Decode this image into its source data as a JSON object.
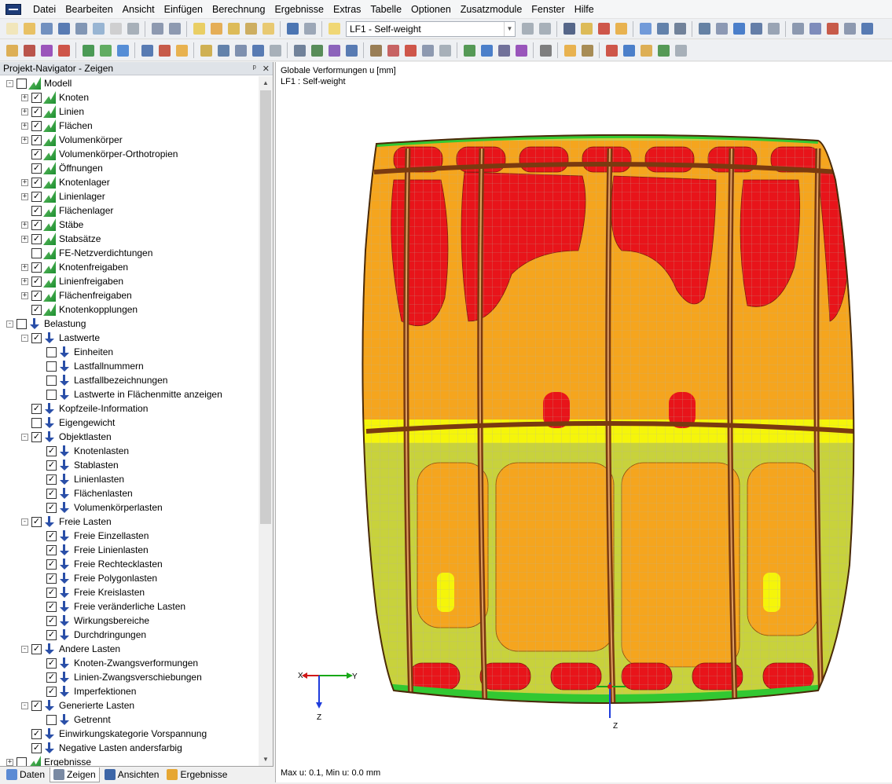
{
  "menu": [
    "Datei",
    "Bearbeiten",
    "Ansicht",
    "Einfügen",
    "Berechnung",
    "Ergebnisse",
    "Extras",
    "Tabelle",
    "Optionen",
    "Zusatzmodule",
    "Fenster",
    "Hilfe"
  ],
  "toolbar": {
    "loadcase": "LF1 - Self-weight"
  },
  "navigator": {
    "title": "Projekt-Navigator - Zeigen",
    "pin": "ᵖ",
    "close": "✕",
    "tree": [
      {
        "label": "Modell",
        "level": 0,
        "exp": "-",
        "checked": false,
        "icon": "model"
      },
      {
        "label": "Knoten",
        "level": 1,
        "exp": "+",
        "checked": true,
        "icon": "model"
      },
      {
        "label": "Linien",
        "level": 1,
        "exp": "+",
        "checked": true,
        "icon": "model"
      },
      {
        "label": "Flächen",
        "level": 1,
        "exp": "+",
        "checked": true,
        "icon": "model"
      },
      {
        "label": "Volumenkörper",
        "level": 1,
        "exp": "+",
        "checked": true,
        "icon": "model"
      },
      {
        "label": "Volumenkörper-Orthotropien",
        "level": 1,
        "exp": "",
        "checked": true,
        "icon": "model"
      },
      {
        "label": "Öffnungen",
        "level": 1,
        "exp": "",
        "checked": true,
        "icon": "model"
      },
      {
        "label": "Knotenlager",
        "level": 1,
        "exp": "+",
        "checked": true,
        "icon": "model"
      },
      {
        "label": "Linienlager",
        "level": 1,
        "exp": "+",
        "checked": true,
        "icon": "model"
      },
      {
        "label": "Flächenlager",
        "level": 1,
        "exp": "",
        "checked": true,
        "icon": "model"
      },
      {
        "label": "Stäbe",
        "level": 1,
        "exp": "+",
        "checked": true,
        "icon": "model"
      },
      {
        "label": "Stabsätze",
        "level": 1,
        "exp": "+",
        "checked": true,
        "icon": "model"
      },
      {
        "label": "FE-Netzverdichtungen",
        "level": 1,
        "exp": "",
        "checked": false,
        "icon": "model"
      },
      {
        "label": "Knotenfreigaben",
        "level": 1,
        "exp": "+",
        "checked": true,
        "icon": "model"
      },
      {
        "label": "Linienfreigaben",
        "level": 1,
        "exp": "+",
        "checked": true,
        "icon": "model"
      },
      {
        "label": "Flächenfreigaben",
        "level": 1,
        "exp": "+",
        "checked": true,
        "icon": "model"
      },
      {
        "label": "Knotenkopplungen",
        "level": 1,
        "exp": "",
        "checked": true,
        "icon": "model"
      },
      {
        "label": "Belastung",
        "level": 0,
        "exp": "-",
        "checked": false,
        "icon": "load"
      },
      {
        "label": "Lastwerte",
        "level": 1,
        "exp": "-",
        "checked": true,
        "icon": "load"
      },
      {
        "label": "Einheiten",
        "level": 2,
        "exp": "",
        "checked": false,
        "icon": "load"
      },
      {
        "label": "Lastfallnummern",
        "level": 2,
        "exp": "",
        "checked": false,
        "icon": "load"
      },
      {
        "label": "Lastfallbezeichnungen",
        "level": 2,
        "exp": "",
        "checked": false,
        "icon": "load"
      },
      {
        "label": "Lastwerte in Flächenmitte anzeigen",
        "level": 2,
        "exp": "",
        "checked": false,
        "icon": "load"
      },
      {
        "label": "Kopfzeile-Information",
        "level": 1,
        "exp": "",
        "checked": true,
        "icon": "load"
      },
      {
        "label": "Eigengewicht",
        "level": 1,
        "exp": "",
        "checked": false,
        "icon": "load"
      },
      {
        "label": "Objektlasten",
        "level": 1,
        "exp": "-",
        "checked": true,
        "icon": "load"
      },
      {
        "label": "Knotenlasten",
        "level": 2,
        "exp": "",
        "checked": true,
        "icon": "load"
      },
      {
        "label": "Stablasten",
        "level": 2,
        "exp": "",
        "checked": true,
        "icon": "load"
      },
      {
        "label": "Linienlasten",
        "level": 2,
        "exp": "",
        "checked": true,
        "icon": "load"
      },
      {
        "label": "Flächenlasten",
        "level": 2,
        "exp": "",
        "checked": true,
        "icon": "load"
      },
      {
        "label": "Volumenkörperlasten",
        "level": 2,
        "exp": "",
        "checked": true,
        "icon": "load"
      },
      {
        "label": "Freie Lasten",
        "level": 1,
        "exp": "-",
        "checked": true,
        "icon": "load"
      },
      {
        "label": "Freie Einzellasten",
        "level": 2,
        "exp": "",
        "checked": true,
        "icon": "load"
      },
      {
        "label": "Freie Linienlasten",
        "level": 2,
        "exp": "",
        "checked": true,
        "icon": "load"
      },
      {
        "label": "Freie Rechtecklasten",
        "level": 2,
        "exp": "",
        "checked": true,
        "icon": "load"
      },
      {
        "label": "Freie Polygonlasten",
        "level": 2,
        "exp": "",
        "checked": true,
        "icon": "load"
      },
      {
        "label": "Freie Kreislasten",
        "level": 2,
        "exp": "",
        "checked": true,
        "icon": "load"
      },
      {
        "label": "Freie veränderliche Lasten",
        "level": 2,
        "exp": "",
        "checked": true,
        "icon": "load"
      },
      {
        "label": "Wirkungsbereiche",
        "level": 2,
        "exp": "",
        "checked": true,
        "icon": "load"
      },
      {
        "label": "Durchdringungen",
        "level": 2,
        "exp": "",
        "checked": true,
        "icon": "load"
      },
      {
        "label": "Andere Lasten",
        "level": 1,
        "exp": "-",
        "checked": true,
        "icon": "load"
      },
      {
        "label": "Knoten-Zwangsverformungen",
        "level": 2,
        "exp": "",
        "checked": true,
        "icon": "load"
      },
      {
        "label": "Linien-Zwangsverschiebungen",
        "level": 2,
        "exp": "",
        "checked": true,
        "icon": "load"
      },
      {
        "label": "Imperfektionen",
        "level": 2,
        "exp": "",
        "checked": true,
        "icon": "load"
      },
      {
        "label": "Generierte Lasten",
        "level": 1,
        "exp": "-",
        "checked": true,
        "icon": "load"
      },
      {
        "label": "Getrennt",
        "level": 2,
        "exp": "",
        "checked": false,
        "icon": "load"
      },
      {
        "label": "Einwirkungskategorie Vorspannung",
        "level": 1,
        "exp": "",
        "checked": true,
        "icon": "load"
      },
      {
        "label": "Negative Lasten andersfarbig",
        "level": 1,
        "exp": "",
        "checked": true,
        "icon": "load"
      },
      {
        "label": "Ergebnisse",
        "level": 0,
        "exp": "+",
        "checked": false,
        "icon": "model"
      }
    ],
    "tabs": [
      "Daten",
      "Zeigen",
      "Ansichten",
      "Ergebnisse"
    ],
    "active_tab": "Zeigen"
  },
  "viewport": {
    "header_line1": "Globale Verformungen u [mm]",
    "header_line2": "LF1 : Self-weight",
    "footer": "Max u: 0.1, Min u: 0.0 mm",
    "axis_x": "X",
    "axis_y": "Y",
    "axis_z": "Z",
    "model_axis_z": "Z"
  },
  "colors": {
    "red": "#e8141a",
    "orange": "#f5a51e",
    "yellow_green": "#c8d23c",
    "yellow": "#f5f50a",
    "green": "#32c832",
    "blue": "#1e3cdc",
    "rib": "#7a3a10"
  }
}
